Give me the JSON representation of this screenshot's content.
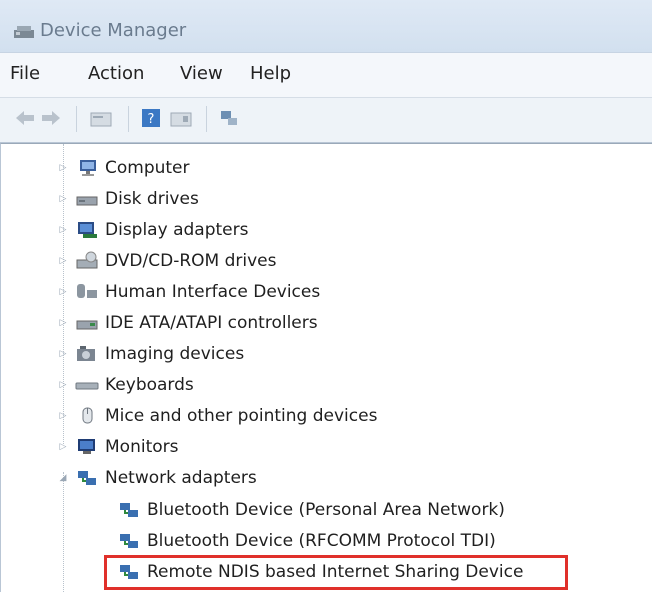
{
  "window": {
    "title": "Device Manager"
  },
  "menu": [
    "File",
    "Action",
    "View",
    "Help"
  ],
  "tree": {
    "categories": [
      {
        "label": "Computer",
        "icon": "computer-icon",
        "expanded": false
      },
      {
        "label": "Disk drives",
        "icon": "disk-drive-icon",
        "expanded": false
      },
      {
        "label": "Display adapters",
        "icon": "display-adapter-icon",
        "expanded": false
      },
      {
        "label": "DVD/CD-ROM drives",
        "icon": "dvd-drive-icon",
        "expanded": false
      },
      {
        "label": "Human Interface Devices",
        "icon": "hid-icon",
        "expanded": false
      },
      {
        "label": "IDE ATA/ATAPI controllers",
        "icon": "ide-controller-icon",
        "expanded": false
      },
      {
        "label": "Imaging devices",
        "icon": "camera-icon",
        "expanded": false
      },
      {
        "label": "Keyboards",
        "icon": "keyboard-icon",
        "expanded": false
      },
      {
        "label": "Mice and other pointing devices",
        "icon": "mouse-icon",
        "expanded": false
      },
      {
        "label": "Monitors",
        "icon": "monitor-icon",
        "expanded": false
      },
      {
        "label": "Network adapters",
        "icon": "network-adapter-icon",
        "expanded": true
      }
    ],
    "network_children": [
      "Bluetooth Device (Personal Area Network)",
      "Bluetooth Device (RFCOMM Protocol TDI)",
      "Remote NDIS based Internet Sharing Device"
    ]
  },
  "highlight_color": "#e0302a"
}
